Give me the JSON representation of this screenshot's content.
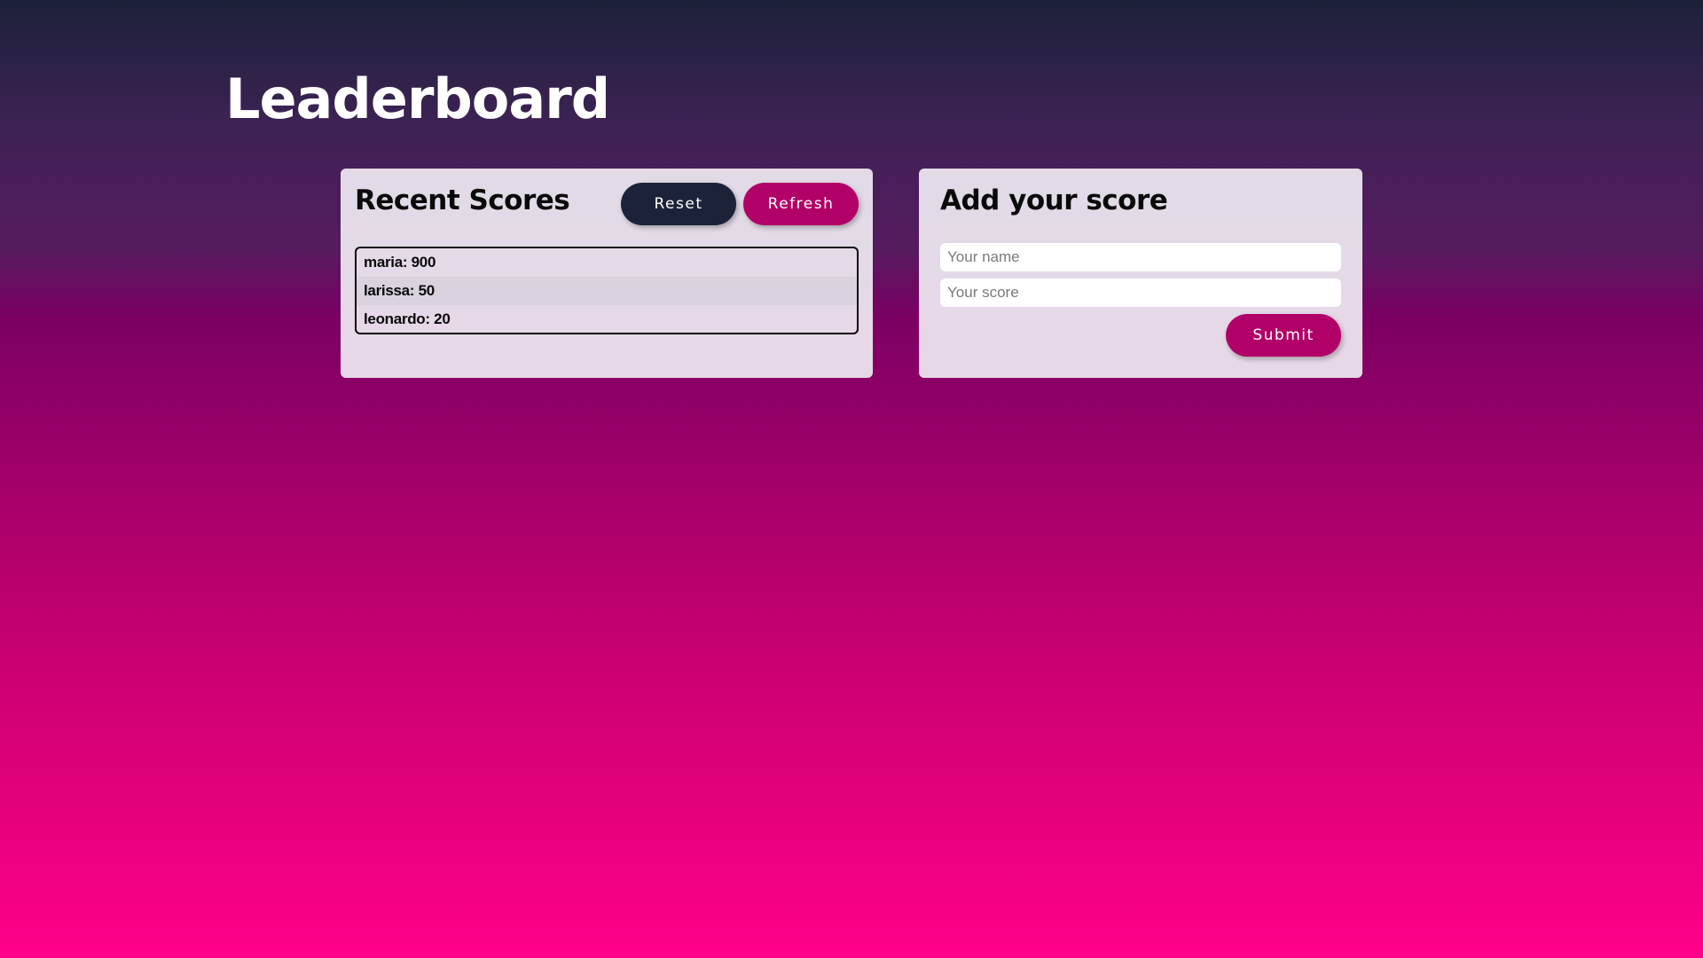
{
  "page": {
    "title": "Leaderboard"
  },
  "recent_scores": {
    "heading": "Recent Scores",
    "reset_label": "Reset",
    "refresh_label": "Refresh",
    "entries": [
      {
        "text": "maria: 900"
      },
      {
        "text": "larissa: 50"
      },
      {
        "text": "leonardo: 20"
      }
    ]
  },
  "add_score": {
    "heading": "Add your score",
    "name_placeholder": "Your name",
    "name_value": "",
    "score_placeholder": "Your score",
    "score_value": "",
    "submit_label": "Submit"
  },
  "colors": {
    "gradient_top": "#1c2139",
    "gradient_bottom": "#ff008a",
    "accent": "#b10067",
    "dark_button": "#1c2339",
    "card_background": "#eee8f1"
  }
}
